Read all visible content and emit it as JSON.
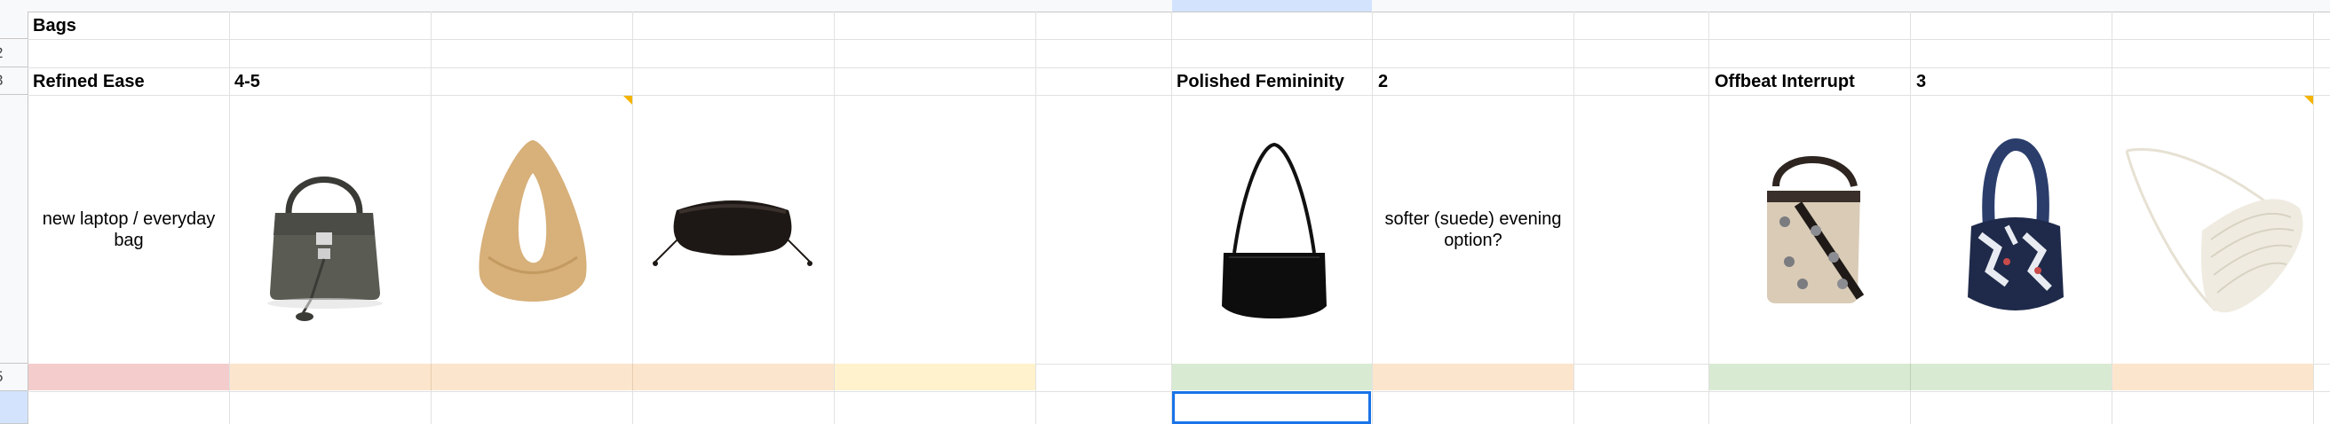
{
  "sheet": {
    "row_numbers": [
      "",
      "2",
      "3",
      "",
      "5",
      ""
    ],
    "title": "Bags",
    "groups": [
      {
        "name": "Refined Ease",
        "count": "4-5",
        "note": "new laptop / everyday bag"
      },
      {
        "name": "Polished Femininity",
        "count": "2",
        "note": "softer (suede) evening option?"
      },
      {
        "name": "Offbeat Interrupt",
        "count": "3"
      }
    ],
    "colors": {
      "pink": "#f4cccc",
      "orange": "#fce5cd",
      "yellow": "#fff2cc",
      "green": "#d9ead3",
      "selection": "#1a73e8",
      "grid": "#e1e1e1",
      "header": "#f8f9fa"
    },
    "images": [
      "grey-top-handle-bag-image",
      "woven-raffia-hobo-bag-image",
      "black-drawstring-pouch-image",
      "black-shoulder-bag-image",
      "embellished-bucket-bag-image",
      "printed-hobo-bag-image",
      "pleated-cream-shoulder-bag-image"
    ]
  }
}
